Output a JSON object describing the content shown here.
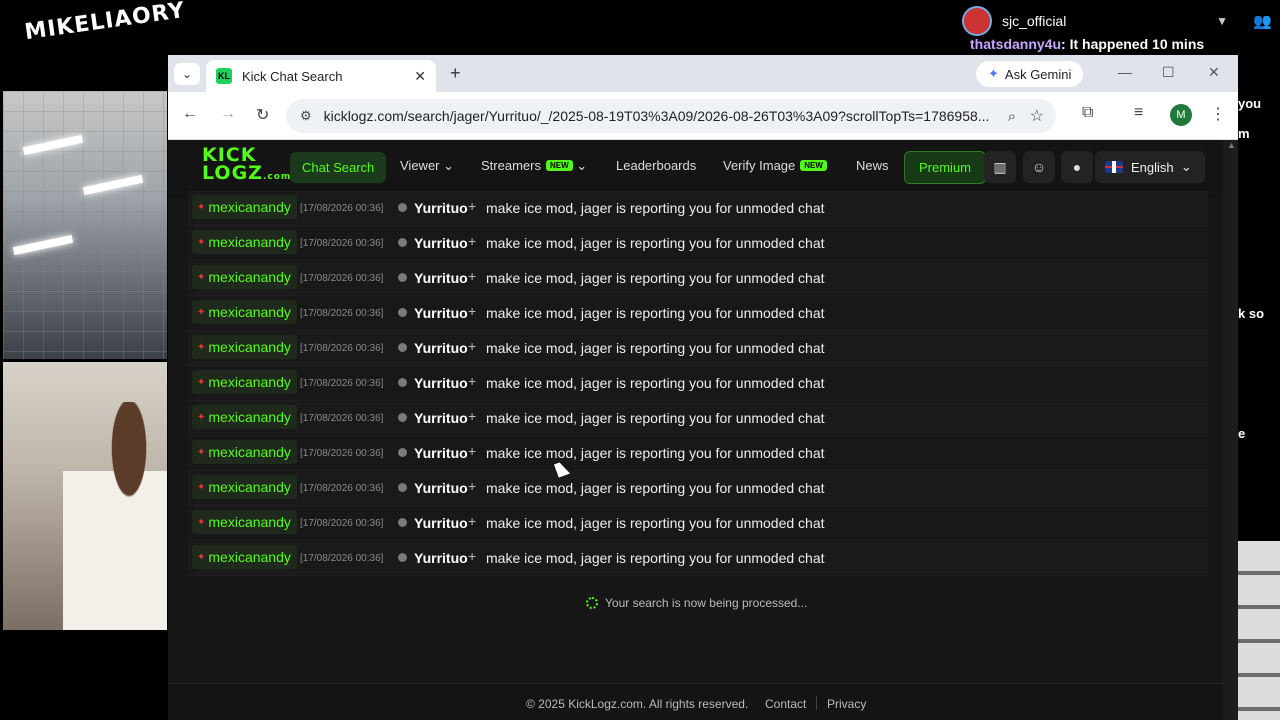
{
  "stream": {
    "logo": "MIKELIAORY",
    "user": "sjc_official",
    "chat_user": "thatsdanny4u",
    "chat_msg": "It happened 10 mins",
    "fragments": [
      "you",
      "m",
      "k so",
      "e"
    ]
  },
  "browser": {
    "tab_title": "Kick Chat Search",
    "tab_favicon": "KL",
    "gemini": "Ask Gemini",
    "url": "kicklogz.com/search/jager/Yurrituo/_/2025-08-19T03%3A09/2026-08-26T03%3A09?scrollTopTs=1786958...",
    "profile_initial": "M"
  },
  "site": {
    "brand_line1": "KICK",
    "brand_line2": "LOGZ",
    "brand_suffix": ".com",
    "nav": {
      "chat_search": "Chat Search",
      "viewer": "Viewer",
      "streamers": "Streamers",
      "new_badge": "NEW",
      "leaderboards": "Leaderboards",
      "verify_image": "Verify Image",
      "news": "News",
      "premium": "Premium",
      "language": "English"
    },
    "rows": [
      {
        "user": "mexicanandy",
        "ts": "[17/08/2026 00:36]",
        "target": "Yurrituo",
        "msg": "make ice mod, jager is reporting you for unmoded chat"
      },
      {
        "user": "mexicanandy",
        "ts": "[17/08/2026 00:36]",
        "target": "Yurrituo",
        "msg": "make ice mod, jager is reporting you for unmoded chat"
      },
      {
        "user": "mexicanandy",
        "ts": "[17/08/2026 00:36]",
        "target": "Yurrituo",
        "msg": "make ice mod, jager is reporting you for unmoded chat"
      },
      {
        "user": "mexicanandy",
        "ts": "[17/08/2026 00:36]",
        "target": "Yurrituo",
        "msg": "make ice mod, jager is reporting you for unmoded chat"
      },
      {
        "user": "mexicanandy",
        "ts": "[17/08/2026 00:36]",
        "target": "Yurrituo",
        "msg": "make ice mod, jager is reporting you for unmoded chat"
      },
      {
        "user": "mexicanandy",
        "ts": "[17/08/2026 00:36]",
        "target": "Yurrituo",
        "msg": "make ice mod, jager is reporting you for unmoded chat"
      },
      {
        "user": "mexicanandy",
        "ts": "[17/08/2026 00:36]",
        "target": "Yurrituo",
        "msg": "make ice mod, jager is reporting you for unmoded chat"
      },
      {
        "user": "mexicanandy",
        "ts": "[17/08/2026 00:36]",
        "target": "Yurrituo",
        "msg": "make ice mod, jager is reporting you for unmoded chat"
      },
      {
        "user": "mexicanandy",
        "ts": "[17/08/2026 00:36]",
        "target": "Yurrituo",
        "msg": "make ice mod, jager is reporting you for unmoded chat"
      },
      {
        "user": "mexicanandy",
        "ts": "[17/08/2026 00:36]",
        "target": "Yurrituo",
        "msg": "make ice mod, jager is reporting you for unmoded chat"
      },
      {
        "user": "mexicanandy",
        "ts": "[17/08/2026 00:36]",
        "target": "Yurrituo",
        "msg": "make ice mod, jager is reporting you for unmoded chat"
      }
    ],
    "processing": "Your search is now being processed...",
    "footer": {
      "copyright": "© 2025 KickLogz.com. All rights reserved.",
      "contact": "Contact",
      "privacy": "Privacy"
    }
  },
  "colors": {
    "kick_green": "#53fc18",
    "site_bg": "#161616"
  }
}
